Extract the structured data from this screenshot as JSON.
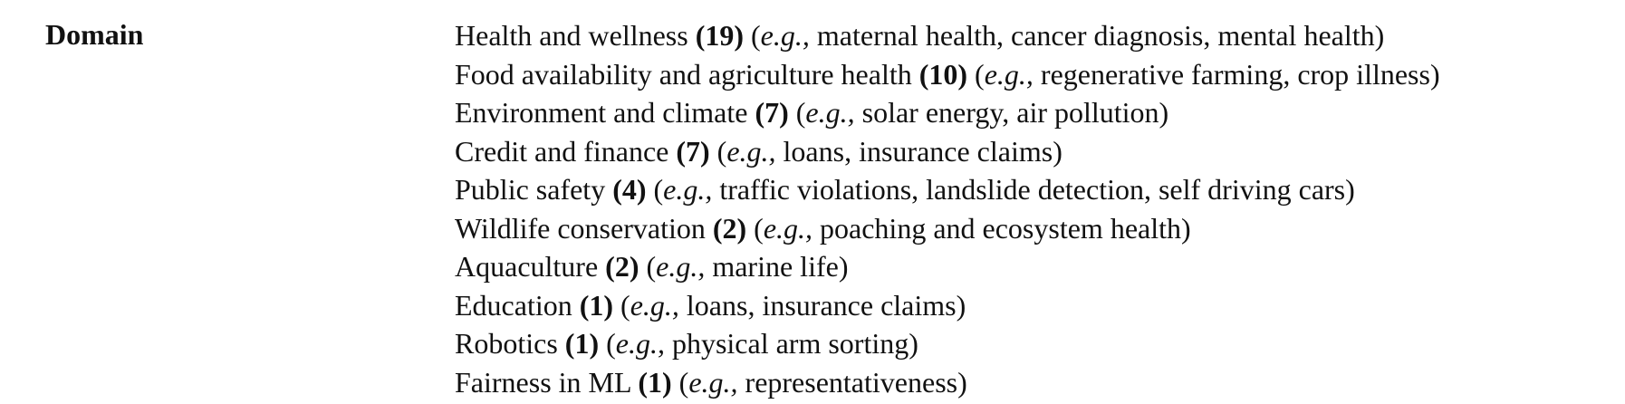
{
  "table": {
    "label": "Domain",
    "rows": [
      {
        "domain": "Health and wellness",
        "count": "(19)",
        "eg": "e.g.,",
        "examples": "maternal health, cancer diagnosis, mental health)"
      },
      {
        "domain": "Food availability and agriculture health",
        "count": "(10)",
        "eg": "e.g.,",
        "examples": "regenerative farming, crop illness)"
      },
      {
        "domain": "Environment and climate",
        "count": "(7)",
        "eg": "e.g.,",
        "examples": " solar energy, air pollution)"
      },
      {
        "domain": "Credit and finance",
        "count": "(7)",
        "eg": "e.g.,",
        "examples": "loans, insurance claims)"
      },
      {
        "domain": "Public safety",
        "count": "(4)",
        "eg": "e.g.,",
        "examples": "traffic violations, landslide detection, self driving cars)"
      },
      {
        "domain": "Wildlife conservation",
        "count": "(2)",
        "eg": "e.g.,",
        "examples": "poaching and ecosystem health)"
      },
      {
        "domain": "Aquaculture",
        "count": "(2)",
        "eg": "e.g.,",
        "examples": "marine life)"
      },
      {
        "domain": "Education",
        "count": "(1)",
        "eg": "e.g.,",
        "examples": "loans, insurance claims)"
      },
      {
        "domain": "Robotics",
        "count": "(1)",
        "eg": "e.g.,",
        "examples": " physical arm sorting)"
      },
      {
        "domain": "Fairness in ML",
        "count": "(1)",
        "eg": "e.g.,",
        "examples": " representativeness)"
      }
    ]
  }
}
